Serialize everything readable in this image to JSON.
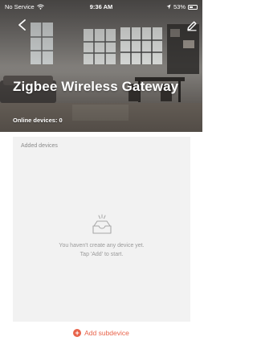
{
  "status_bar": {
    "carrier": "No Service",
    "time": "9:36 AM",
    "battery": "53%",
    "battery_level": 0.53
  },
  "header": {
    "title": "Zigbee Wireless Gateway",
    "online_devices": "Online devices: 0"
  },
  "devices_panel": {
    "label": "Added devices",
    "empty_line1": "You haven't create any device yet.",
    "empty_line2": "Tap 'Add' to start."
  },
  "footer": {
    "add_label": "Add subdevice"
  },
  "colors": {
    "accent": "#e8634a",
    "panel_bg": "#f2f2f2",
    "muted_text": "#9a9a9a"
  }
}
